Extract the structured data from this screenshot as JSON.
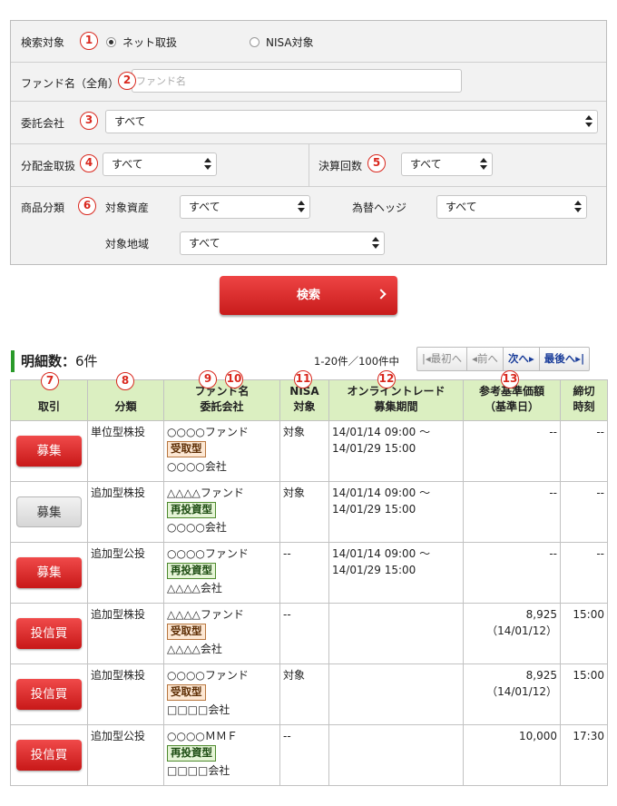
{
  "search": {
    "target_label": "検索対象",
    "target_options": [
      {
        "label": "ネット取扱",
        "checked": true
      },
      {
        "label": "NISA対象",
        "checked": false
      }
    ],
    "fund_name_label": "ファンド名（全角）",
    "fund_name_placeholder": "ファンド名",
    "consignor_label": "委託会社",
    "consignor_value": "すべて",
    "dividend_label": "分配金取扱",
    "dividend_value": "すべて",
    "settlement_label": "決算回数",
    "settlement_value": "すべて",
    "category_label": "商品分類",
    "asset_label": "対象資産",
    "asset_value": "すべて",
    "hedge_label": "為替ヘッジ",
    "hedge_value": "すべて",
    "region_label": "対象地域",
    "region_value": "すべて",
    "search_button": "検索"
  },
  "annotations": [
    "1",
    "2",
    "3",
    "4",
    "5",
    "6",
    "7",
    "8",
    "9",
    "10",
    "11",
    "12",
    "13"
  ],
  "results": {
    "title": "明細数：",
    "count": "6件",
    "range": "1-20件／100件中",
    "pager": {
      "first": "最初へ",
      "prev": "前へ",
      "next": "次へ",
      "last": "最後へ"
    },
    "headers": {
      "trade": "取引",
      "class": "分類",
      "fund_name": "ファンド名",
      "company": "委託会社",
      "nisa_1": "NISA",
      "nisa_2": "対象",
      "online_1": "オンライントレード",
      "online_2": "募集期間",
      "nav_1": "参考基準価額",
      "nav_2": "（基準日）",
      "cutoff_1": "締切",
      "cutoff_2": "時刻"
    },
    "rows": [
      {
        "action": "募集",
        "style": "red",
        "class": "単位型株投",
        "fund": "○○○○ファンド",
        "badge": "受取型",
        "badge_type": "uke",
        "company": "○○○○会社",
        "nisa": "対象",
        "period_1": "14/01/14 09:00 ～",
        "period_2": "14/01/29 15:00",
        "nav": "--",
        "nav_date": "",
        "cutoff": "--"
      },
      {
        "action": "募集",
        "style": "gray",
        "class": "追加型株投",
        "fund": "△△△△ファンド",
        "badge": "再投資型",
        "badge_type": "sai",
        "company": "○○○○会社",
        "nisa": "対象",
        "period_1": "14/01/14 09:00 ～",
        "period_2": "14/01/29 15:00",
        "nav": "--",
        "nav_date": "",
        "cutoff": "--"
      },
      {
        "action": "募集",
        "style": "red",
        "class": "追加型公投",
        "fund": "○○○○ファンド",
        "badge": "再投資型",
        "badge_type": "sai",
        "company": "△△△△会社",
        "nisa": "--",
        "period_1": "14/01/14 09:00 ～",
        "period_2": "14/01/29 15:00",
        "nav": "--",
        "nav_date": "",
        "cutoff": "--"
      },
      {
        "action": "投信買",
        "style": "red",
        "class": "追加型株投",
        "fund": "△△△△ファンド",
        "badge": "受取型",
        "badge_type": "uke",
        "company": "△△△△会社",
        "nisa": "--",
        "period_1": "",
        "period_2": "",
        "nav": "8,925",
        "nav_date": "（14/01/12）",
        "cutoff": "15:00"
      },
      {
        "action": "投信買",
        "style": "red",
        "class": "追加型株投",
        "fund": "○○○○ファンド",
        "badge": "受取型",
        "badge_type": "uke",
        "company": "□□□□会社",
        "nisa": "対象",
        "period_1": "",
        "period_2": "",
        "nav": "8,925",
        "nav_date": "（14/01/12）",
        "cutoff": "15:00"
      },
      {
        "action": "投信買",
        "style": "red",
        "class": "追加型公投",
        "fund": "○○○○ＭＭＦ",
        "badge": "再投資型",
        "badge_type": "sai",
        "company": "□□□□会社",
        "nisa": "--",
        "period_1": "",
        "period_2": "",
        "nav": "10,000",
        "nav_date": "",
        "cutoff": "17:30"
      }
    ]
  }
}
